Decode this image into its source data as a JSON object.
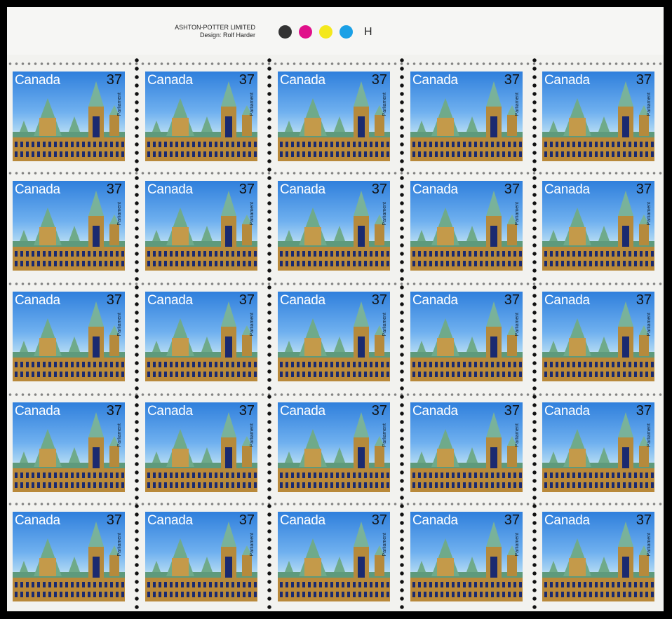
{
  "imprint": {
    "printer": "ASHTON-POTTER LIMITED",
    "designer": "Design: Rolf Harder"
  },
  "color_dots": [
    "#333333",
    "#e0108a",
    "#f4e81c",
    "#1aa0e6"
  ],
  "plate_letter": "H",
  "stamp": {
    "country": "Canada",
    "denomination": "37",
    "subject": "Parliament"
  },
  "grid": {
    "rows": 5,
    "columns": 5
  }
}
